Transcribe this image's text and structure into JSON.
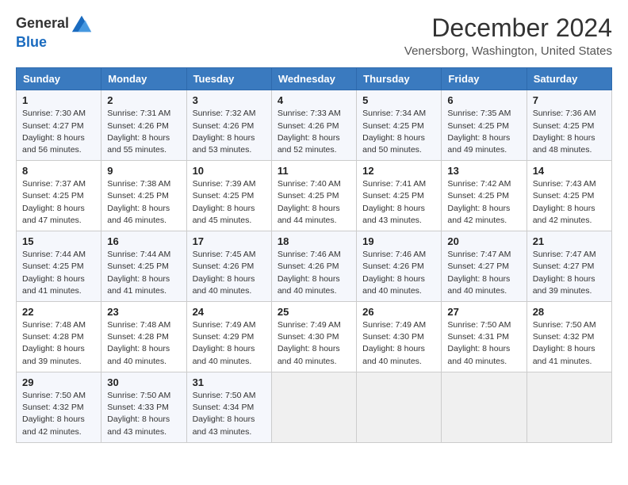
{
  "logo": {
    "general": "General",
    "blue": "Blue"
  },
  "title": "December 2024",
  "subtitle": "Venersborg, Washington, United States",
  "headers": [
    "Sunday",
    "Monday",
    "Tuesday",
    "Wednesday",
    "Thursday",
    "Friday",
    "Saturday"
  ],
  "weeks": [
    [
      {
        "day": "1",
        "sunrise": "7:30 AM",
        "sunset": "4:27 PM",
        "daylight": "8 hours and 56 minutes."
      },
      {
        "day": "2",
        "sunrise": "7:31 AM",
        "sunset": "4:26 PM",
        "daylight": "8 hours and 55 minutes."
      },
      {
        "day": "3",
        "sunrise": "7:32 AM",
        "sunset": "4:26 PM",
        "daylight": "8 hours and 53 minutes."
      },
      {
        "day": "4",
        "sunrise": "7:33 AM",
        "sunset": "4:26 PM",
        "daylight": "8 hours and 52 minutes."
      },
      {
        "day": "5",
        "sunrise": "7:34 AM",
        "sunset": "4:25 PM",
        "daylight": "8 hours and 50 minutes."
      },
      {
        "day": "6",
        "sunrise": "7:35 AM",
        "sunset": "4:25 PM",
        "daylight": "8 hours and 49 minutes."
      },
      {
        "day": "7",
        "sunrise": "7:36 AM",
        "sunset": "4:25 PM",
        "daylight": "8 hours and 48 minutes."
      }
    ],
    [
      {
        "day": "8",
        "sunrise": "7:37 AM",
        "sunset": "4:25 PM",
        "daylight": "8 hours and 47 minutes."
      },
      {
        "day": "9",
        "sunrise": "7:38 AM",
        "sunset": "4:25 PM",
        "daylight": "8 hours and 46 minutes."
      },
      {
        "day": "10",
        "sunrise": "7:39 AM",
        "sunset": "4:25 PM",
        "daylight": "8 hours and 45 minutes."
      },
      {
        "day": "11",
        "sunrise": "7:40 AM",
        "sunset": "4:25 PM",
        "daylight": "8 hours and 44 minutes."
      },
      {
        "day": "12",
        "sunrise": "7:41 AM",
        "sunset": "4:25 PM",
        "daylight": "8 hours and 43 minutes."
      },
      {
        "day": "13",
        "sunrise": "7:42 AM",
        "sunset": "4:25 PM",
        "daylight": "8 hours and 42 minutes."
      },
      {
        "day": "14",
        "sunrise": "7:43 AM",
        "sunset": "4:25 PM",
        "daylight": "8 hours and 42 minutes."
      }
    ],
    [
      {
        "day": "15",
        "sunrise": "7:44 AM",
        "sunset": "4:25 PM",
        "daylight": "8 hours and 41 minutes."
      },
      {
        "day": "16",
        "sunrise": "7:44 AM",
        "sunset": "4:25 PM",
        "daylight": "8 hours and 41 minutes."
      },
      {
        "day": "17",
        "sunrise": "7:45 AM",
        "sunset": "4:26 PM",
        "daylight": "8 hours and 40 minutes."
      },
      {
        "day": "18",
        "sunrise": "7:46 AM",
        "sunset": "4:26 PM",
        "daylight": "8 hours and 40 minutes."
      },
      {
        "day": "19",
        "sunrise": "7:46 AM",
        "sunset": "4:26 PM",
        "daylight": "8 hours and 40 minutes."
      },
      {
        "day": "20",
        "sunrise": "7:47 AM",
        "sunset": "4:27 PM",
        "daylight": "8 hours and 40 minutes."
      },
      {
        "day": "21",
        "sunrise": "7:47 AM",
        "sunset": "4:27 PM",
        "daylight": "8 hours and 39 minutes."
      }
    ],
    [
      {
        "day": "22",
        "sunrise": "7:48 AM",
        "sunset": "4:28 PM",
        "daylight": "8 hours and 39 minutes."
      },
      {
        "day": "23",
        "sunrise": "7:48 AM",
        "sunset": "4:28 PM",
        "daylight": "8 hours and 40 minutes."
      },
      {
        "day": "24",
        "sunrise": "7:49 AM",
        "sunset": "4:29 PM",
        "daylight": "8 hours and 40 minutes."
      },
      {
        "day": "25",
        "sunrise": "7:49 AM",
        "sunset": "4:30 PM",
        "daylight": "8 hours and 40 minutes."
      },
      {
        "day": "26",
        "sunrise": "7:49 AM",
        "sunset": "4:30 PM",
        "daylight": "8 hours and 40 minutes."
      },
      {
        "day": "27",
        "sunrise": "7:50 AM",
        "sunset": "4:31 PM",
        "daylight": "8 hours and 40 minutes."
      },
      {
        "day": "28",
        "sunrise": "7:50 AM",
        "sunset": "4:32 PM",
        "daylight": "8 hours and 41 minutes."
      }
    ],
    [
      {
        "day": "29",
        "sunrise": "7:50 AM",
        "sunset": "4:32 PM",
        "daylight": "8 hours and 42 minutes."
      },
      {
        "day": "30",
        "sunrise": "7:50 AM",
        "sunset": "4:33 PM",
        "daylight": "8 hours and 43 minutes."
      },
      {
        "day": "31",
        "sunrise": "7:50 AM",
        "sunset": "4:34 PM",
        "daylight": "8 hours and 43 minutes."
      },
      null,
      null,
      null,
      null
    ]
  ],
  "labels": {
    "sunrise": "Sunrise:",
    "sunset": "Sunset:",
    "daylight": "Daylight:"
  }
}
